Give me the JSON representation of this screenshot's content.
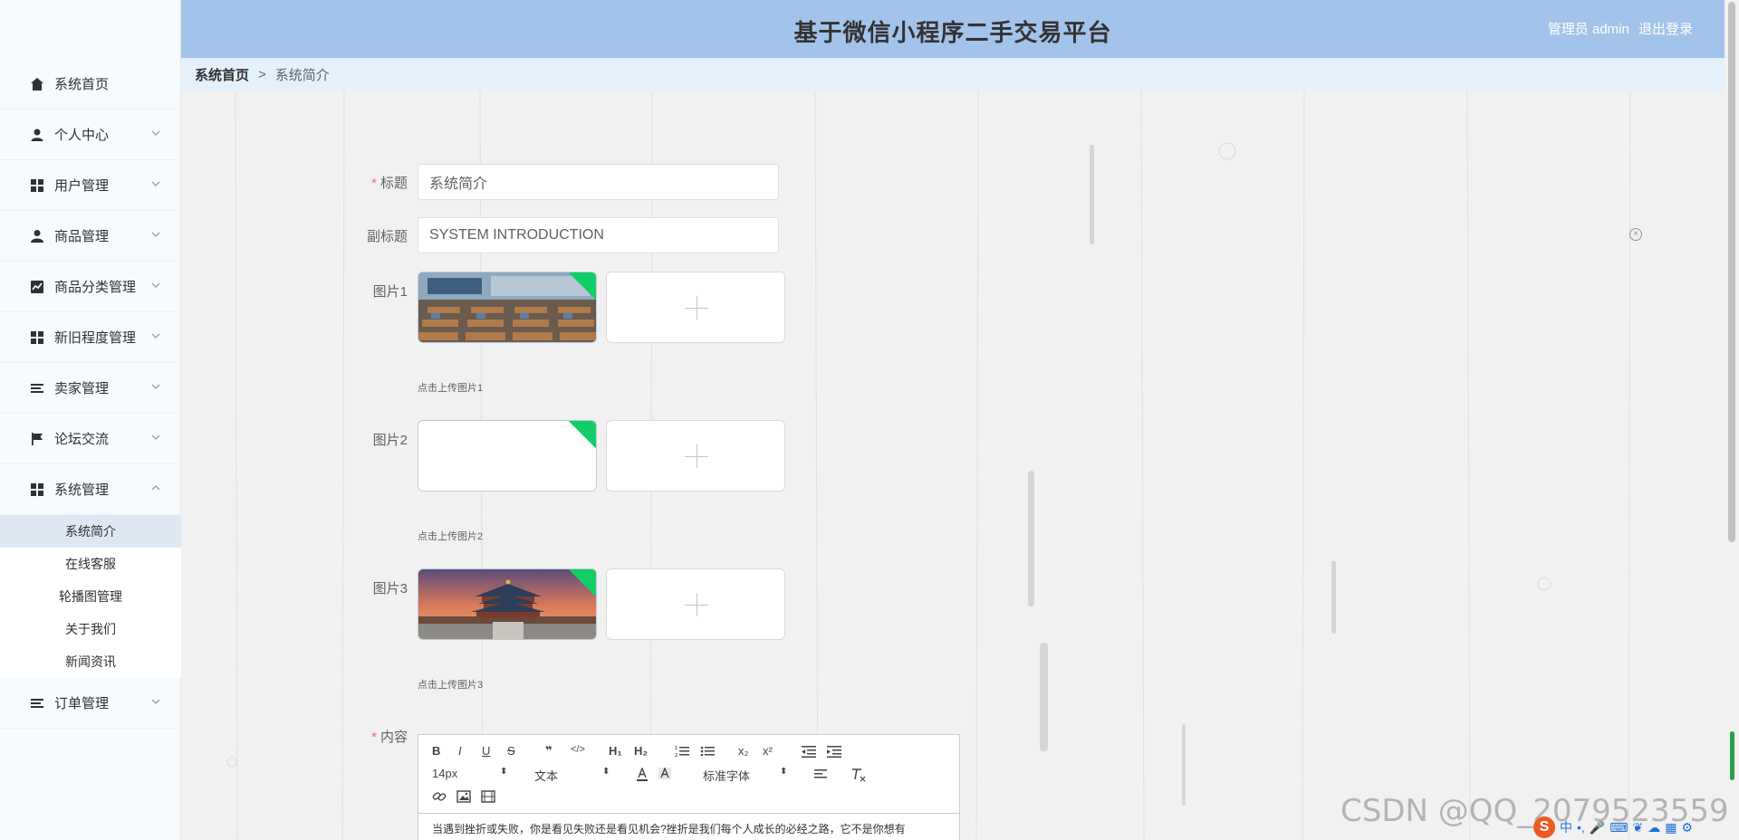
{
  "header": {
    "title": "基于微信小程序二手交易平台",
    "user_label": "管理员 admin",
    "logout_label": "退出登录"
  },
  "breadcrumb": {
    "home": "系统首页",
    "separator": ">",
    "current": "系统简介"
  },
  "sidebar": {
    "items": [
      {
        "label": "系统首页",
        "icon": "home-icon",
        "has_arrow": false
      },
      {
        "label": "个人中心",
        "icon": "user-icon",
        "has_arrow": true
      },
      {
        "label": "用户管理",
        "icon": "grid-icon",
        "has_arrow": true
      },
      {
        "label": "商品管理",
        "icon": "person-icon",
        "has_arrow": true
      },
      {
        "label": "商品分类管理",
        "icon": "chart-icon",
        "has_arrow": true
      },
      {
        "label": "新旧程度管理",
        "icon": "grid-icon",
        "has_arrow": true
      },
      {
        "label": "卖家管理",
        "icon": "list-icon",
        "has_arrow": true
      },
      {
        "label": "论坛交流",
        "icon": "flag-icon",
        "has_arrow": true
      },
      {
        "label": "系统管理",
        "icon": "grid-icon",
        "has_arrow": true,
        "expanded": true
      },
      {
        "label": "订单管理",
        "icon": "list-icon",
        "has_arrow": true
      }
    ],
    "submenu": [
      {
        "label": "系统简介",
        "active": true
      },
      {
        "label": "在线客服"
      },
      {
        "label": "轮播图管理"
      },
      {
        "label": "关于我们"
      },
      {
        "label": "新闻资讯"
      }
    ]
  },
  "form": {
    "title_label": "标题",
    "title_value": "系统简介",
    "subtitle_label": "副标题",
    "subtitle_value": "SYSTEM INTRODUCTION",
    "image1_label": "图片1",
    "image1_tip": "点击上传图片1",
    "image2_label": "图片2",
    "image2_tip": "点击上传图片2",
    "image3_label": "图片3",
    "image3_tip": "点击上传图片3",
    "content_label": "内容",
    "required_mark": "*"
  },
  "editor": {
    "bold": "B",
    "italic": "I",
    "underline": "U",
    "strike": "S",
    "quote": "❞",
    "code": "</>",
    "h1": "H₁",
    "h2": "H₂",
    "subscript": "x₂",
    "superscript": "x²",
    "size_value": "14px",
    "header_value": "文本",
    "font_value": "标准字体",
    "content_text": "当遇到挫折或失败，你是看见失败还是看见机会?挫折是我们每个人成长的必经之路，它不是你想有"
  },
  "watermark": "CSDN @QQ_2079523559",
  "ime": {
    "logo": "S",
    "mode": "中"
  },
  "colors": {
    "header_bg": "#a3c4ea",
    "breadcrumb_bg": "#e4f1fb",
    "sidebar_bg": "#f7fbfe",
    "active_submenu_bg": "#dde8f2",
    "success_corner": "#13ce66",
    "required": "#f56c6c"
  }
}
